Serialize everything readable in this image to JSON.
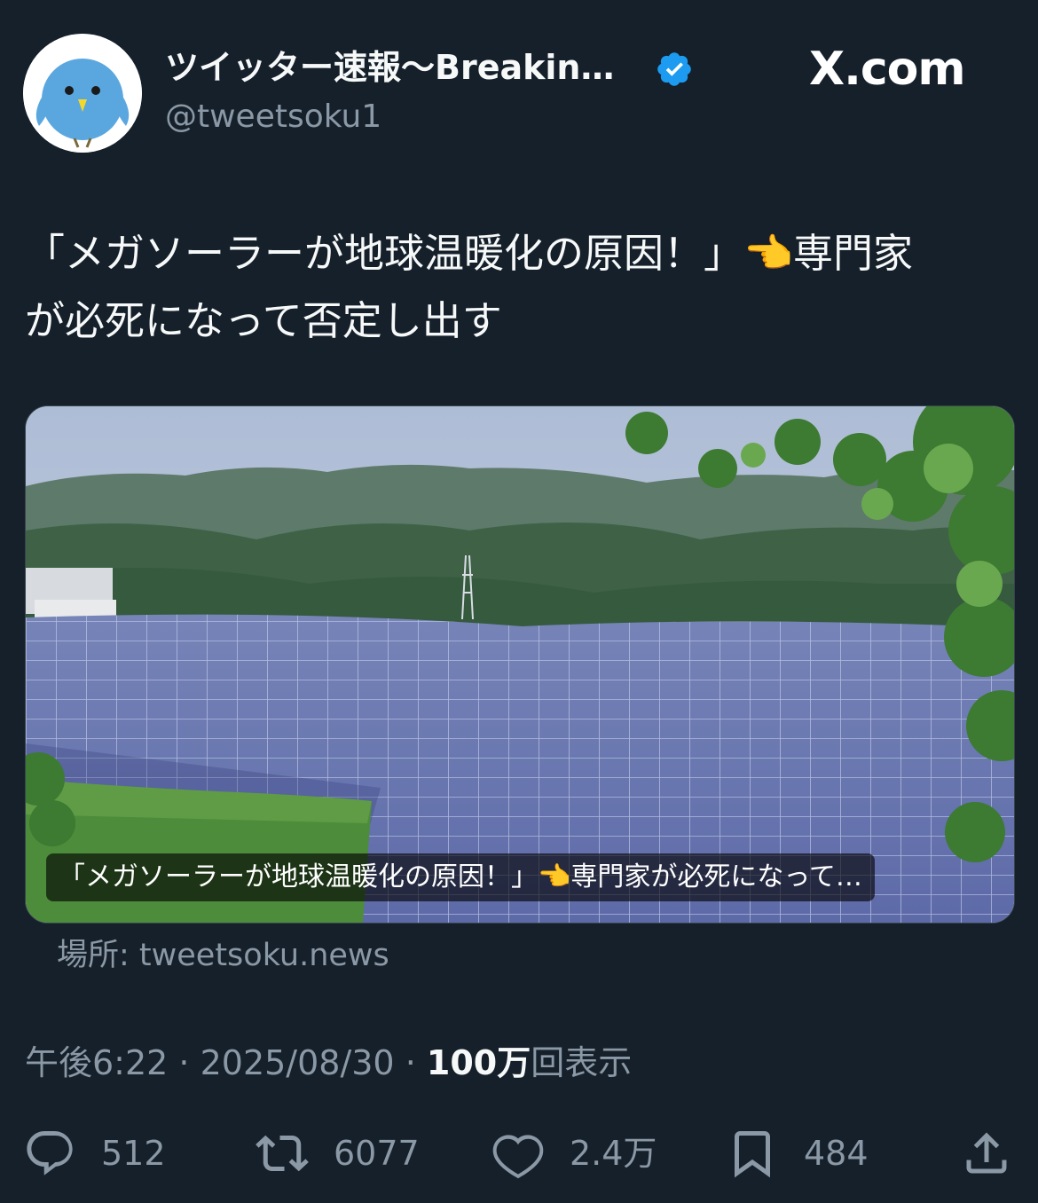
{
  "header": {
    "display_name": "ツイッター速報〜Breakin…",
    "handle": "@tweetsoku1",
    "brand": "X.com",
    "accent_color": "#1d9bf0"
  },
  "tweet": {
    "text_line1": "「メガソーラーが地球温暖化の原因！」👈専門家",
    "text_line2": "が必死になって否定し出す"
  },
  "card": {
    "caption": "「メガソーラーが地球温暖化の原因！」👈専門家が必死になって…",
    "source": "場所: tweetsoku.news"
  },
  "meta": {
    "time": "午後6:22",
    "sep1": " · ",
    "date": "2025/08/30",
    "sep2": " · ",
    "views": "100万",
    "views_label": "回表示"
  },
  "actions": {
    "replies": "512",
    "retweets": "6077",
    "likes": "2.4万",
    "bookmarks": "484"
  },
  "icons": {
    "reply": "reply-icon",
    "retweet": "retweet-icon",
    "like": "heart-icon",
    "bookmark": "bookmark-icon",
    "share": "share-icon",
    "verified": "verified-badge-icon"
  }
}
